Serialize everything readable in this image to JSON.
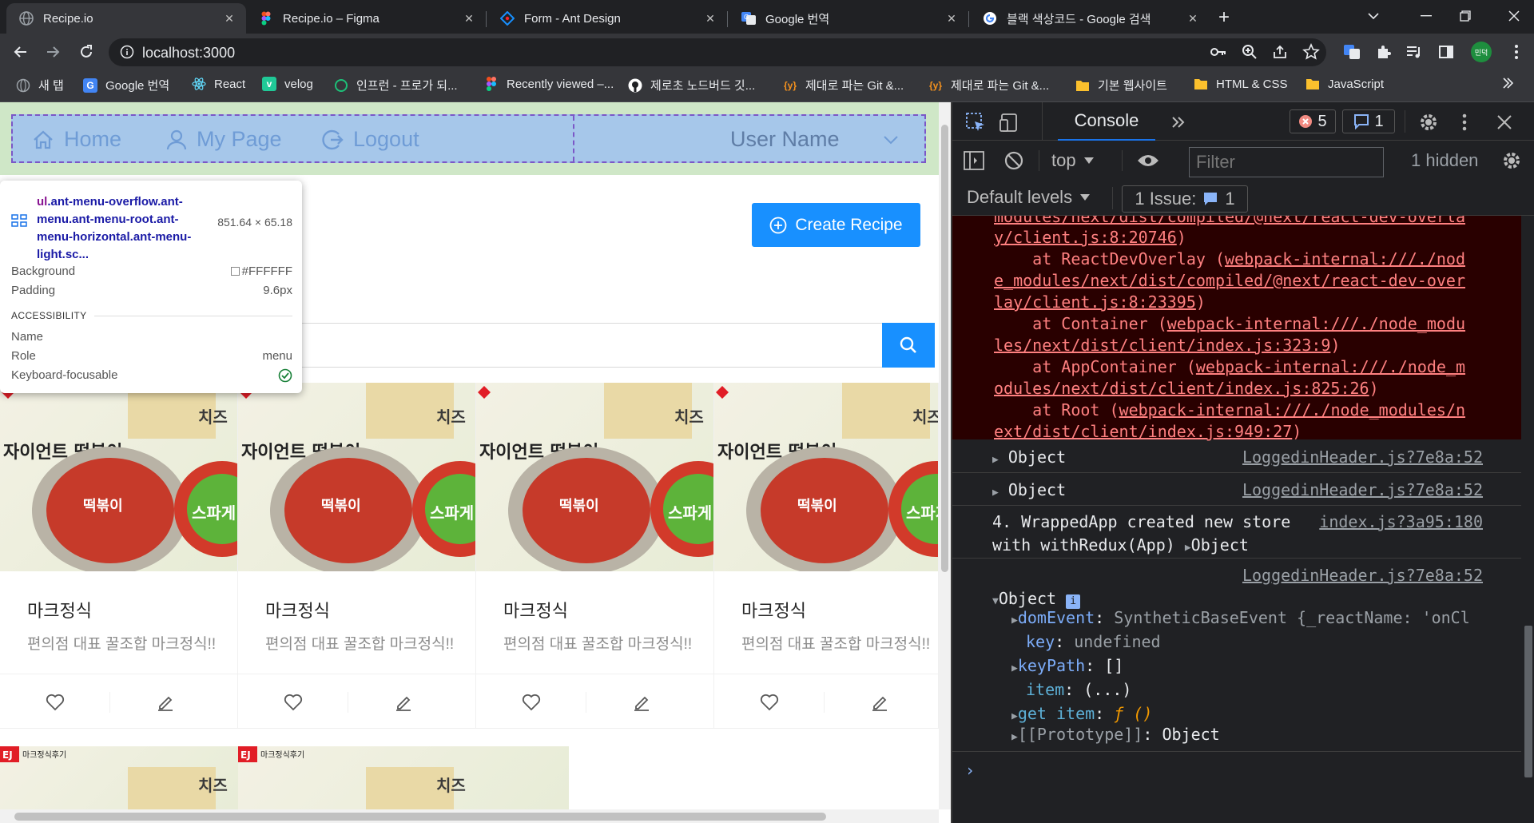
{
  "browser": {
    "tabs": [
      {
        "title": "Recipe.io",
        "active": true,
        "favicon": "globe-icon"
      },
      {
        "title": "Recipe.io – Figma",
        "active": false,
        "favicon": "figma-icon"
      },
      {
        "title": "Form - Ant Design",
        "active": false,
        "favicon": "ant-design-icon"
      },
      {
        "title": "Google 번역",
        "active": false,
        "favicon": "google-translate-icon"
      },
      {
        "title": "블랙 색상코드 - Google 검색",
        "active": false,
        "favicon": "google-icon"
      }
    ],
    "url": "localhost:3000",
    "profile_label": "민덕",
    "bookmarks": [
      {
        "label": "새 탭",
        "icon": "globe-icon",
        "color": "#9aa0a6"
      },
      {
        "label": "Google 번역",
        "icon": "google-translate-icon",
        "color": "#4285f4"
      },
      {
        "label": "React",
        "icon": "react-icon",
        "color": "#61dafb"
      },
      {
        "label": "velog",
        "icon": "velog-icon",
        "color": "#20c997"
      },
      {
        "label": "인프런 - 프로가 되...",
        "icon": "inflearn-icon",
        "color": "#1dc078"
      },
      {
        "label": "Recently viewed –...",
        "icon": "figma-icon",
        "color": "#f24e1e"
      },
      {
        "label": "제로초 노드버드 깃...",
        "icon": "github-icon",
        "color": "#ffffff"
      },
      {
        "label": "제대로 파는 Git &...",
        "icon": "yalco-icon",
        "color": "#f7931e"
      },
      {
        "label": "제대로 파는 Git &...",
        "icon": "yalco-icon",
        "color": "#f7931e"
      },
      {
        "label": "기본 웹사이트",
        "icon": "folder-icon",
        "color": "#fbc02d"
      },
      {
        "label": "HTML & CSS",
        "icon": "folder-icon",
        "color": "#fbc02d"
      },
      {
        "label": "JavaScript",
        "icon": "folder-icon",
        "color": "#fbc02d"
      }
    ]
  },
  "page": {
    "menu": {
      "home": "Home",
      "mypage": "My Page",
      "logout": "Logout",
      "username": "User Name"
    },
    "tooltip": {
      "selector_tag": "ul",
      "selector_rest": ".ant-menu-overflow.ant-menu.ant-menu-root.ant-menu-horizontal.ant-menu-light.sc...",
      "size": "851.64 × 65.18",
      "background_label": "Background",
      "background_value": "#FFFFFF",
      "padding_label": "Padding",
      "padding_value": "9.6px",
      "accessibility_heading": "ACCESSIBILITY",
      "name_label": "Name",
      "role_label": "Role",
      "role_value": "menu",
      "focusable_label": "Keyboard-focusable"
    },
    "create_button": "Create Recipe",
    "cards": [
      {
        "title": "마크정식",
        "desc": "편의점 대표 꿀조합 마크정식!!"
      },
      {
        "title": "마크정식",
        "desc": "편의점 대표 꿀조합 마크정식!!"
      },
      {
        "title": "마크정식",
        "desc": "편의점 대표 꿀조합 마크정식!!"
      },
      {
        "title": "마크정식",
        "desc": "편의점 대표 꿀조합 마크정식!!"
      }
    ],
    "card_image_text": {
      "badge": "EJ",
      "badge_caption": "마크정식후기",
      "cheese": "치즈",
      "giant": "자이언트 떡볶이",
      "spaghetti": "스파게티",
      "cup": "떡볶이"
    }
  },
  "devtools": {
    "active_tab": "Console",
    "error_count": "5",
    "message_count": "1",
    "context": "top",
    "filter_placeholder": "Filter",
    "hidden_label": "1 hidden",
    "levels_label": "Default levels",
    "issues_label": "1 Issue:",
    "issues_count": "1",
    "error_lines": [
      {
        "pre": "",
        "link": "modules/next/dist/compiled/@next/react-dev-overla",
        "post": ""
      },
      {
        "pre": "",
        "link": "y/client.js:8:20746",
        "post": ")"
      },
      {
        "pre": "    at ReactDevOverlay (",
        "link": "webpack-internal:///./nod",
        "post": ""
      },
      {
        "pre": "",
        "link": "e_modules/next/dist/compiled/@next/react-dev-over",
        "post": ""
      },
      {
        "pre": "",
        "link": "lay/client.js:8:23395",
        "post": ")"
      },
      {
        "pre": "    at Container (",
        "link": "webpack-internal:///./node_modu",
        "post": ""
      },
      {
        "pre": "",
        "link": "les/next/dist/client/index.js:323:9",
        "post": ")"
      },
      {
        "pre": "    at AppContainer (",
        "link": "webpack-internal:///./node_m",
        "post": ""
      },
      {
        "pre": "",
        "link": "odules/next/dist/client/index.js:825:26",
        "post": ")"
      },
      {
        "pre": "    at Root (",
        "link": "webpack-internal:///./node_modules/n",
        "post": ""
      },
      {
        "pre": "",
        "link": "ext/dist/client/index.js:949:27",
        "post": ")"
      }
    ],
    "object_label": "Object",
    "source_header": "LoggedinHeader.js?7e8a:52",
    "wrapped_line1": "4. WrappedApp created new store",
    "wrapped_line2": "with withRedux(App)",
    "source_index": "index.js?3a95:180",
    "props": {
      "domEvent_key": "domEvent",
      "domEvent_val": "SyntheticBaseEvent {_reactName: 'onCl",
      "key_key": "key",
      "key_val": "undefined",
      "keyPath_key": "keyPath",
      "keyPath_val": "[]",
      "item_key": "item",
      "item_val": "(...)",
      "getitem_key": "get item",
      "getitem_val": "ƒ ()",
      "proto_key": "[[Prototype]]",
      "proto_val": "Object"
    }
  }
}
